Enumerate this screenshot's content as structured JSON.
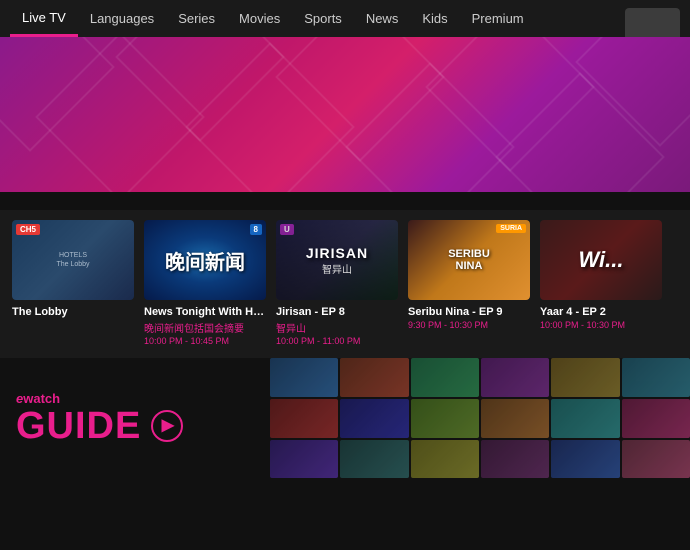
{
  "nav": {
    "items": [
      {
        "label": "Live TV",
        "active": true
      },
      {
        "label": "Languages",
        "active": false
      },
      {
        "label": "Series",
        "active": false
      },
      {
        "label": "Movies",
        "active": false
      },
      {
        "label": "Sports",
        "active": false
      },
      {
        "label": "News",
        "active": false
      },
      {
        "label": "Kids",
        "active": false
      },
      {
        "label": "Premium",
        "active": false
      }
    ]
  },
  "cards": [
    {
      "id": "hotels",
      "channel": "CH5",
      "channel_class": "ch5",
      "title": "The Lobby",
      "subtitle": "",
      "time": "",
      "thumb_text": "HOTELS",
      "thumb_sub": "The Lobby"
    },
    {
      "id": "news",
      "channel": "8",
      "channel_class": "ch8",
      "title": "News Tonight With Highlights From Pa...",
      "subtitle": "晚间新闻包括国会摘要",
      "time": "10:00 PM - 10:45 PM",
      "thumb_text": "晚间新闻",
      "thumb_sub": ""
    },
    {
      "id": "jirisan",
      "channel": "U",
      "channel_class": "u",
      "title": "Jirisan - EP 8",
      "subtitle": "智异山",
      "time": "10:00 PM - 11:00 PM",
      "thumb_text": "JIRISAN",
      "thumb_sub": "智异山"
    },
    {
      "id": "nina",
      "channel": "SURIA",
      "channel_class": "suria",
      "title": "Seribu Nina - EP 9",
      "subtitle": "",
      "time": "9:30 PM - 10:30 PM",
      "thumb_text": "SERIBU NINA",
      "thumb_sub": ""
    },
    {
      "id": "yaar",
      "channel": "",
      "channel_class": "",
      "title": "Yaar 4 - EP 2",
      "subtitle": "",
      "time": "10:00 PM - 10:30 PM",
      "thumb_text": "Wi...",
      "thumb_sub": ""
    }
  ],
  "guide": {
    "brand": "e",
    "brand_suffix": "watch",
    "title": "GUIDE",
    "arrow_symbol": "▶"
  }
}
